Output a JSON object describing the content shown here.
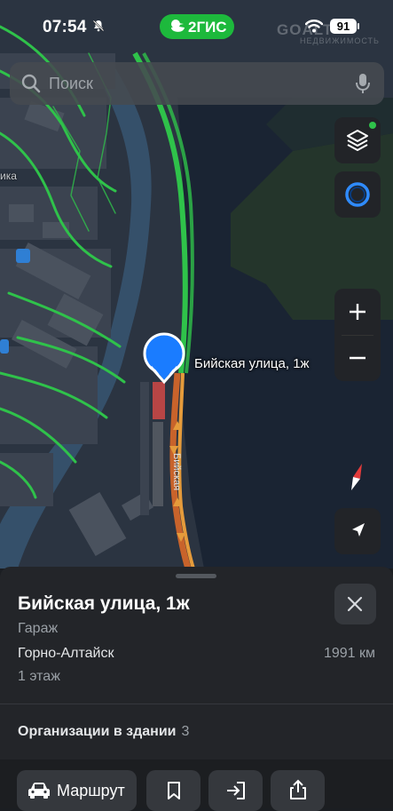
{
  "status_bar": {
    "time": "07:54",
    "battery": "91",
    "watermark": "GOALT",
    "watermark_sub": "НЕДВИЖИМОСТЬ"
  },
  "app_badge": {
    "label": "2ГИС",
    "color": "#1db93c"
  },
  "search": {
    "placeholder": "Поиск",
    "icon": "search-icon",
    "mic_icon": "microphone-icon"
  },
  "map": {
    "marker_label": "Бийская улица, 1ж",
    "edge_label": "ика",
    "street_name": "Бийская",
    "buttons": [
      "layers-icon",
      "assistant-icon",
      "zoom-in-icon",
      "zoom-out-icon",
      "compass-icon",
      "my-location-icon"
    ]
  },
  "place": {
    "title": "Бийская улица, 1ж",
    "category": "Гараж",
    "city": "Горно-Алтайск",
    "distance": "1991 км",
    "floor": "1 этаж",
    "organizations_label": "Организации в здании",
    "organizations_count": "3"
  },
  "actions": {
    "route_label": "Маршрут",
    "bookmark": "bookmark-icon",
    "enter": "entrance-icon",
    "share": "share-icon"
  },
  "colors": {
    "traffic_green": "#2fc24a",
    "traffic_orange": "#e58a2b",
    "marker_blue": "#1a7cff",
    "sheet_bg": "#232529"
  }
}
